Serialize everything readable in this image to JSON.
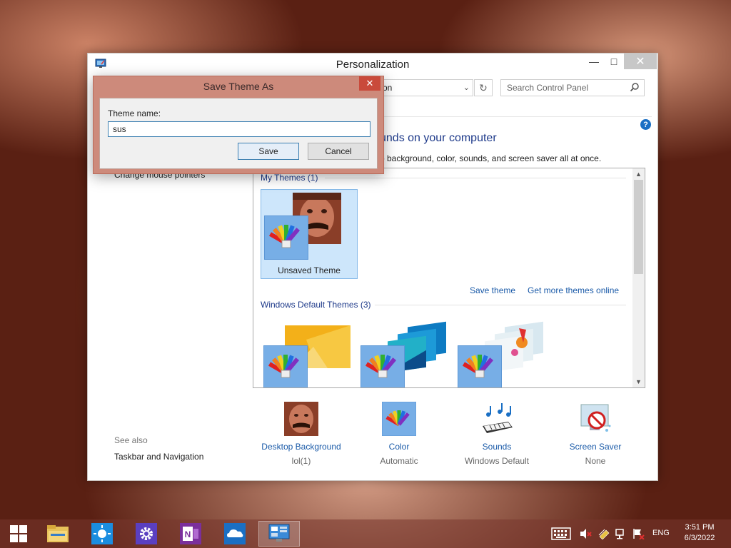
{
  "window": {
    "title": "Personalization",
    "address_partial": "on",
    "search_placeholder": "Search Control Panel",
    "heading_partial": "unds on your computer",
    "subheading_partial": "p background, color, sounds, and screen saver all at once.",
    "left_link_partial": "Change mouse pointers",
    "help_icon": "?"
  },
  "themes": {
    "my_themes_label": "My Themes (1)",
    "unsaved_theme_label": "Unsaved Theme",
    "save_theme_link": "Save theme",
    "get_more_link": "Get more themes online",
    "windows_default_label": "Windows Default Themes (3)"
  },
  "bottom": {
    "desktop_background": {
      "label": "Desktop Background",
      "value": "lol(1)"
    },
    "color": {
      "label": "Color",
      "value": "Automatic"
    },
    "sounds": {
      "label": "Sounds",
      "value": "Windows Default"
    },
    "screen_saver": {
      "label": "Screen Saver",
      "value": "None"
    }
  },
  "see_also": {
    "label": "See also",
    "taskbar_navigation": "Taskbar and Navigation"
  },
  "dialog": {
    "title": "Save Theme As",
    "field_label": "Theme name:",
    "field_value": "sus",
    "save_label": "Save",
    "cancel_label": "Cancel"
  },
  "taskbar": {
    "language": "ENG",
    "time": "3:51 PM",
    "date": "6/3/2022"
  },
  "colors": {
    "link_blue": "#1a5aa8",
    "heading_blue": "#1e3a8a",
    "dialog_frame": "#cd8a7b",
    "close_red": "#c94a3b",
    "selection_blue": "#cde6fb"
  }
}
